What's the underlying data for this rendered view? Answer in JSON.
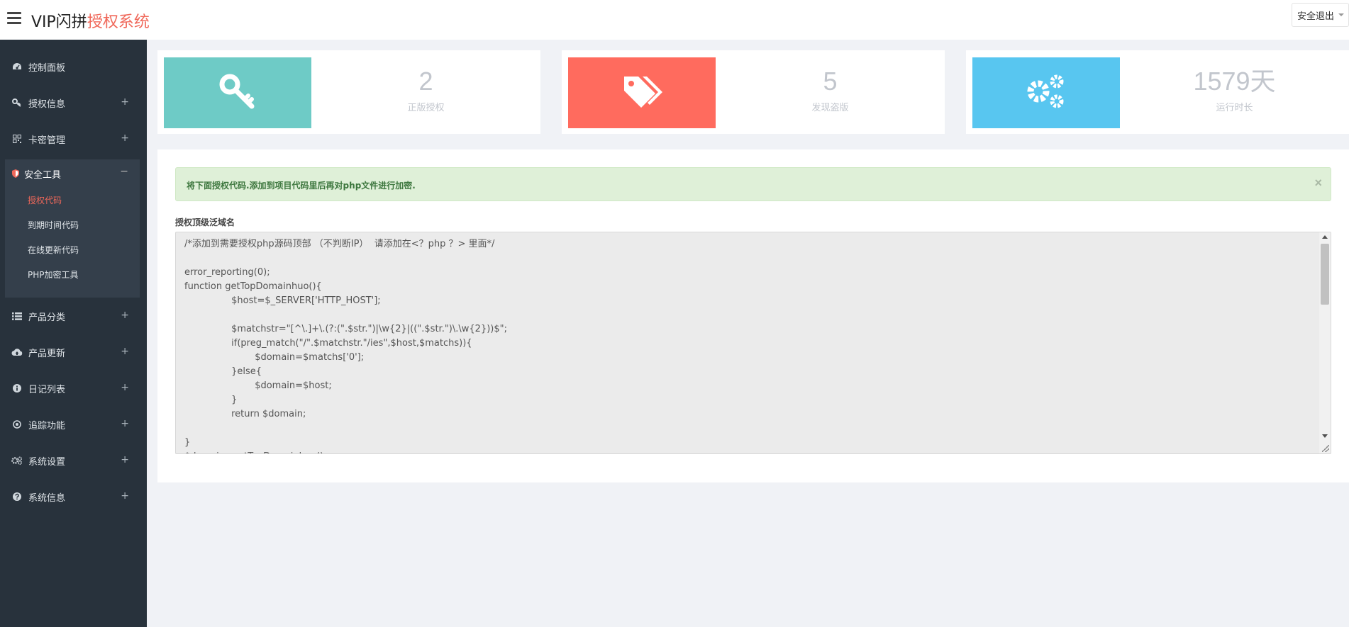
{
  "header": {
    "brand_main": "VIP闪拼",
    "brand_accent": "授权系统",
    "logout_label": "安全退出",
    "accent_color": "#f0685a"
  },
  "sidebar": {
    "items_top": [
      {
        "label": "控制面板",
        "icon": "dashboard-icon",
        "expandable": false
      },
      {
        "label": "授权信息",
        "icon": "key-icon",
        "expandable": true
      },
      {
        "label": "卡密管理",
        "icon": "qrcode-icon",
        "expandable": true
      }
    ],
    "active_group": {
      "label": "安全工具",
      "icon": "shield-icon",
      "children": [
        {
          "label": "授权代码",
          "active": true
        },
        {
          "label": "到期时间代码",
          "active": false
        },
        {
          "label": "在线更新代码",
          "active": false
        },
        {
          "label": "PHP加密工具",
          "active": false
        }
      ]
    },
    "items_bottom": [
      {
        "label": "产品分类",
        "icon": "list-icon"
      },
      {
        "label": "产品更新",
        "icon": "cloud-upload-icon"
      },
      {
        "label": "日记列表",
        "icon": "info-icon"
      },
      {
        "label": "追踪功能",
        "icon": "target-icon"
      },
      {
        "label": "系统设置",
        "icon": "gears-icon"
      },
      {
        "label": "系统信息",
        "icon": "question-icon"
      }
    ],
    "expand_symbol": "+",
    "collapse_symbol": "−"
  },
  "stats": [
    {
      "value": "2",
      "label": "正版授权",
      "color": "#6ecbc6",
      "icon": "key-icon"
    },
    {
      "value": "5",
      "label": "发现盗版",
      "color": "#ff6b5e",
      "icon": "tags-icon"
    },
    {
      "value": "1579天",
      "label": "运行时长",
      "color": "#58c6f0",
      "icon": "gears-icon"
    }
  ],
  "main": {
    "alert_text": "将下面授权代码.添加到项目代码里后再对php文件进行加密.",
    "alert_close": "×",
    "field_label": "授权顶级泛域名",
    "code": "/*添加到需要授权php源码顶部 （不判断IP）  请添加在<？php ？> 里面*/\n\nerror_reporting(0);\nfunction getTopDomainhuo(){\n\t\t$host=$_SERVER['HTTP_HOST'];\n\t\t\n\t\t$matchstr=\"[^\\.]+\\.(?:(\".$str.\")|\\w{2}|((\".$str.\")\\.\\w{2}))$\";\n\t\tif(preg_match(\"/\".$matchstr.\"/ies\",$host,$matchs)){\n\t\t\t$domain=$matchs['0'];\n\t\t}else{\n\t\t\t$domain=$host;\n\t\t}\n\t\treturn $domain;\n\n}\n$domain=getTopDomainhuo();"
  }
}
